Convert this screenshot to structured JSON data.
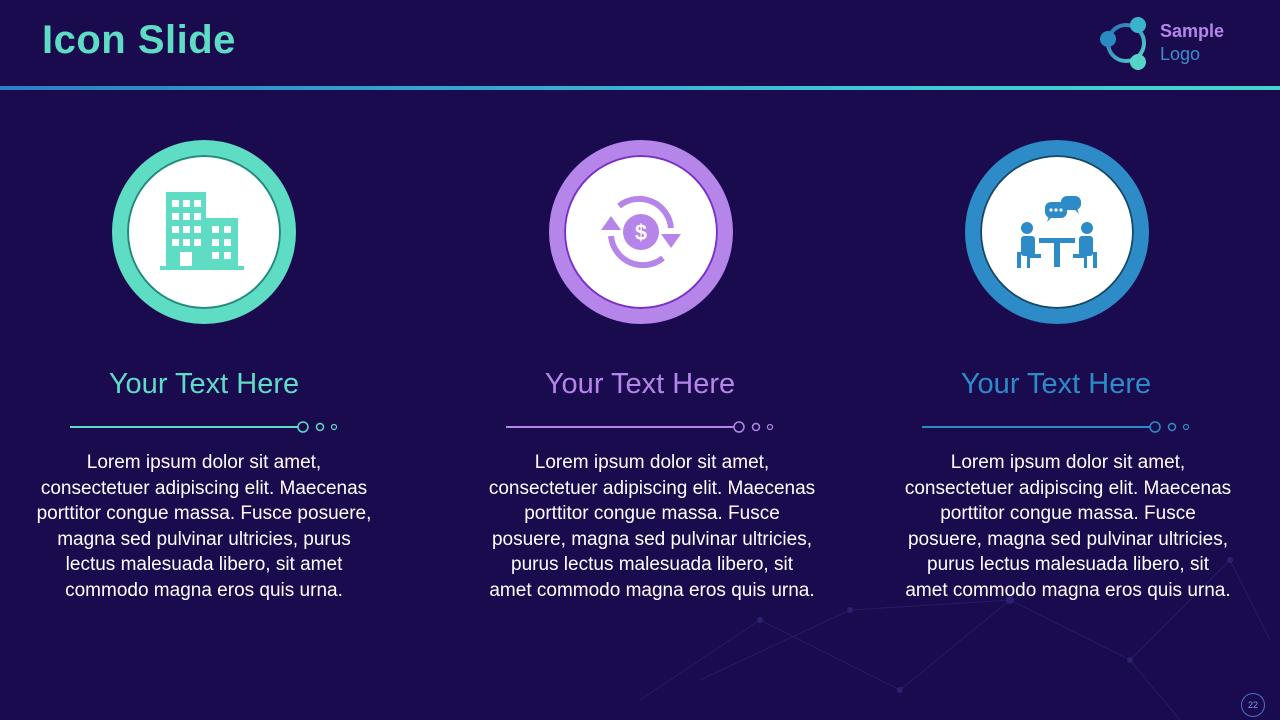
{
  "slide": {
    "title": "Icon Slide",
    "page_number": "22"
  },
  "logo": {
    "line1": "Sample",
    "line2": "Logo"
  },
  "columns": [
    {
      "heading": "Your Text Here",
      "icon": "office-building-icon",
      "accent": "#5fdcc4",
      "body": "Lorem ipsum dolor sit amet, consectetuer adipiscing elit. Maecenas porttitor congue massa. Fusce posuere, magna sed pulvinar ultricies, purus lectus malesuada libero, sit amet commodo magna eros quis urna."
    },
    {
      "heading": "Your Text Here",
      "icon": "dollar-cycle-icon",
      "accent": "#b585ea",
      "body": "Lorem ipsum dolor sit amet, consectetuer adipiscing elit. Maecenas porttitor congue massa. Fusce posuere, magna sed pulvinar ultricies, purus lectus malesuada libero, sit amet commodo magna eros quis urna."
    },
    {
      "heading": "Your Text Here",
      "icon": "meeting-table-icon",
      "accent": "#2d8bc8",
      "body": "Lorem ipsum dolor sit amet, consectetuer adipiscing elit. Maecenas porttitor congue massa. Fusce posuere, magna sed pulvinar ultricies, purus lectus malesuada libero, sit amet commodo magna eros quis urna."
    }
  ],
  "colors": {
    "background": "#1a0b4f",
    "title": "#5fdcc4",
    "teal": "#5fdcc4",
    "purple": "#b585ea",
    "blue": "#2d8bc8"
  }
}
